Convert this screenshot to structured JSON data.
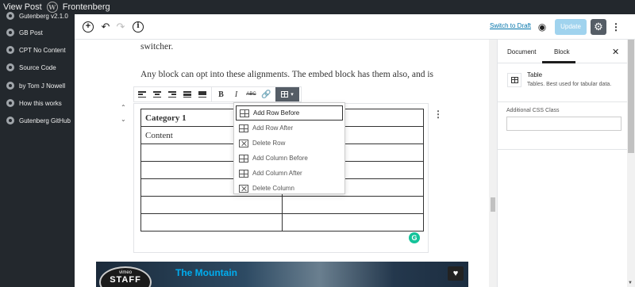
{
  "admin_bar": {
    "view_post": "View Post",
    "site_name": "Frontenberg"
  },
  "sidebar": {
    "items": [
      {
        "label": "Gutenberg v2.1.0"
      },
      {
        "label": "GB Post"
      },
      {
        "label": "CPT No Content"
      },
      {
        "label": "Source Code"
      },
      {
        "label": "by Tom J Nowell"
      },
      {
        "label": "How this works"
      },
      {
        "label": "Gutenberg GitHub"
      }
    ]
  },
  "topbar": {
    "switch_to_draft": "Switch to Draft",
    "update": "Update"
  },
  "content": {
    "para_top": "switcher.",
    "para_alignments": "Any block can opt into these alignments. The embed block has them also, and is"
  },
  "table": {
    "rows": [
      [
        "Category 1",
        ""
      ],
      [
        "Content",
        ""
      ],
      [
        "",
        ""
      ],
      [
        "",
        ""
      ],
      [
        "",
        ""
      ],
      [
        "",
        ""
      ],
      [
        "",
        ""
      ]
    ]
  },
  "table_menu": {
    "items": [
      {
        "label": "Add Row Before",
        "icon": "add-row-before-icon",
        "active": true
      },
      {
        "label": "Add Row After",
        "icon": "add-row-after-icon",
        "active": false
      },
      {
        "label": "Delete Row",
        "icon": "delete-row-icon",
        "active": false
      },
      {
        "label": "Add Column Before",
        "icon": "add-column-before-icon",
        "active": false
      },
      {
        "label": "Add Column After",
        "icon": "add-column-after-icon",
        "active": false
      },
      {
        "label": "Delete Column",
        "icon": "delete-column-icon",
        "active": false
      }
    ]
  },
  "embed": {
    "title": "The Mountain",
    "badge_top": "vimeo",
    "badge_main": "STAFF"
  },
  "settings": {
    "tab_document": "Document",
    "tab_block": "Block",
    "block_title": "Table",
    "block_desc": "Tables. Best used for tabular data.",
    "css_label": "Additional CSS Class",
    "css_value": ""
  },
  "colors": {
    "admin_bg": "#23282d",
    "accent_link": "#0073aa",
    "update_disabled": "#a0d3ee",
    "grammarly": "#15c39a",
    "vimeo_blue": "#00adef"
  }
}
